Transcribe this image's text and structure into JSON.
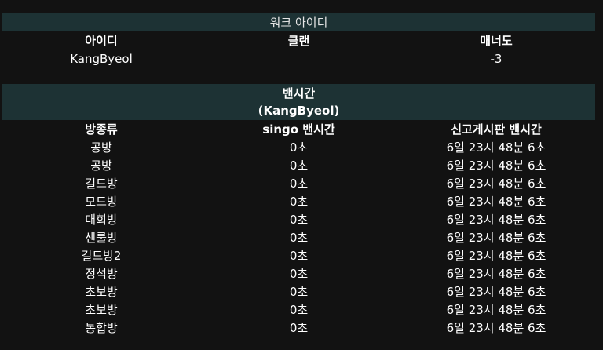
{
  "work": {
    "title": "워크 아이디",
    "headers": [
      "아이디",
      "클랜",
      "매너도"
    ],
    "row": [
      "KangByeol",
      "",
      "-3"
    ]
  },
  "ban": {
    "title": "밴시간",
    "subtitle": "(KangByeol)",
    "headers": [
      "방종류",
      "singo 밴시간",
      "신고게시판 밴시간"
    ],
    "rows": [
      [
        "공방",
        "0초",
        "6일 23시 48분 6초"
      ],
      [
        "공방",
        "0초",
        "6일 23시 48분 6초"
      ],
      [
        "길드방",
        "0초",
        "6일 23시 48분 6초"
      ],
      [
        "모드방",
        "0초",
        "6일 23시 48분 6초"
      ],
      [
        "대회방",
        "0초",
        "6일 23시 48분 6초"
      ],
      [
        "센룰방",
        "0초",
        "6일 23시 48분 6초"
      ],
      [
        "길드방2",
        "0초",
        "6일 23시 48분 6초"
      ],
      [
        "정석방",
        "0초",
        "6일 23시 48분 6초"
      ],
      [
        "초보방",
        "0초",
        "6일 23시 48분 6초"
      ],
      [
        "초보방",
        "0초",
        "6일 23시 48분 6초"
      ],
      [
        "통합방",
        "0초",
        "6일 23시 48분 6초"
      ]
    ]
  },
  "colors": {
    "background": "#121212",
    "header_band": "#1d3234",
    "text": "#ffffff"
  }
}
